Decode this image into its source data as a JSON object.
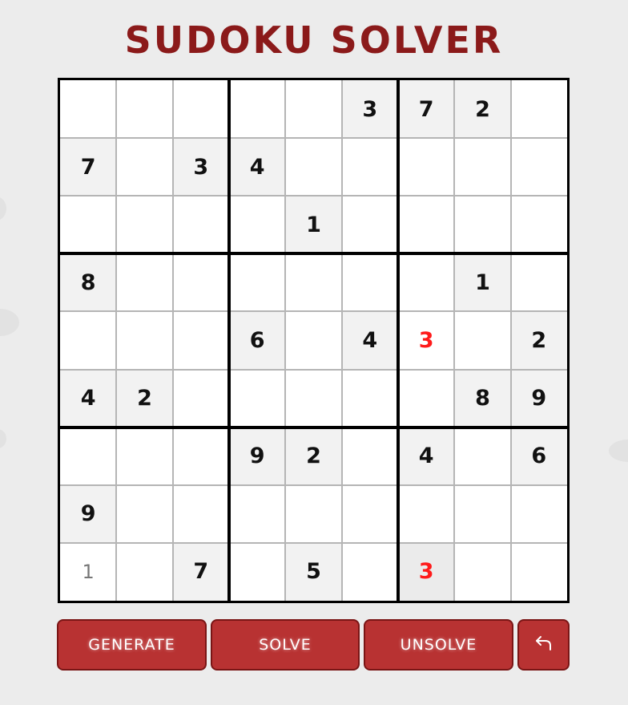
{
  "title": "SUDOKU SOLVER",
  "board": {
    "rows": [
      [
        "",
        "",
        "",
        "",
        "",
        "3",
        "7",
        "2",
        ""
      ],
      [
        "7",
        "",
        "3",
        "4",
        "",
        "",
        "",
        "",
        ""
      ],
      [
        "",
        "",
        "",
        "",
        "1",
        "",
        "",
        "",
        ""
      ],
      [
        "8",
        "",
        "",
        "",
        "",
        "",
        "",
        "1",
        ""
      ],
      [
        "",
        "",
        "",
        "6",
        "",
        "4",
        "3",
        "",
        "2"
      ],
      [
        "4",
        "2",
        "",
        "",
        "",
        "",
        "",
        "8",
        "9"
      ],
      [
        "",
        "",
        "",
        "9",
        "2",
        "",
        "4",
        "",
        "6"
      ],
      [
        "9",
        "",
        "",
        "",
        "",
        "",
        "",
        "",
        ""
      ],
      [
        "1",
        "",
        "7",
        "",
        "5",
        "",
        "3",
        "",
        ""
      ]
    ],
    "error_cells": [
      [
        4,
        6
      ],
      [
        8,
        6
      ]
    ],
    "hint_cells": [
      [
        8,
        0
      ]
    ],
    "selected_cell": [
      8,
      6
    ]
  },
  "buttons": {
    "generate": "GENERATE",
    "solve": "SOLVE",
    "unsolve": "UNSOLVE",
    "undo_icon": "undo-arrow-icon"
  },
  "colors": {
    "title": "#8b1a1a",
    "button_bg": "#b83232",
    "error_digit": "#ff1a1a",
    "given_cell_bg": "#f2f2f2"
  }
}
